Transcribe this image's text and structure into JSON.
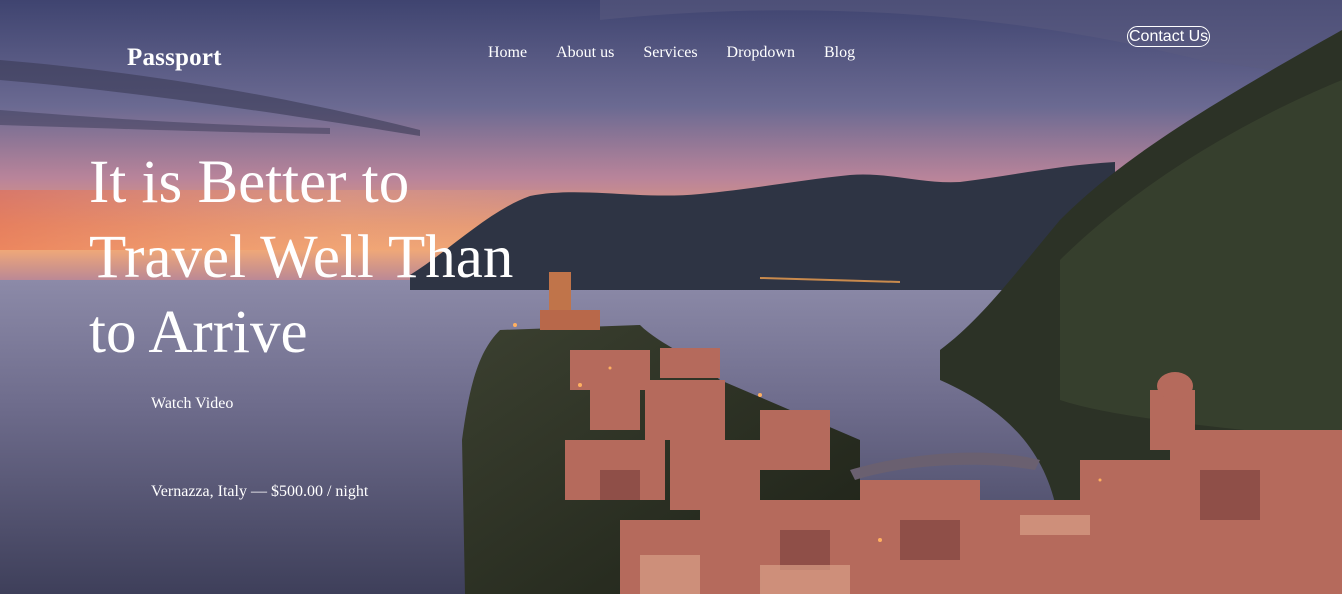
{
  "header": {
    "brand": "Passport",
    "nav": [
      "Home",
      "About us",
      "Services",
      "Dropdown",
      "Blog"
    ],
    "contact_label": "Contact Us"
  },
  "hero": {
    "headline_lines": [
      "It is Better to",
      "Travel Well Than",
      "to Arrive"
    ],
    "watch_video_label": "Watch Video",
    "location_caption": "Vernazza, Italy — $500.00 / night",
    "background": "sunset-coastal-village-photo"
  },
  "colors": {
    "sky_top": "#4a4e78",
    "sky_glow": "#e88a5c",
    "sea": "#4b4d6e",
    "mountain": "#2f3848",
    "buildings": "#b8695a",
    "text": "#ffffff"
  }
}
